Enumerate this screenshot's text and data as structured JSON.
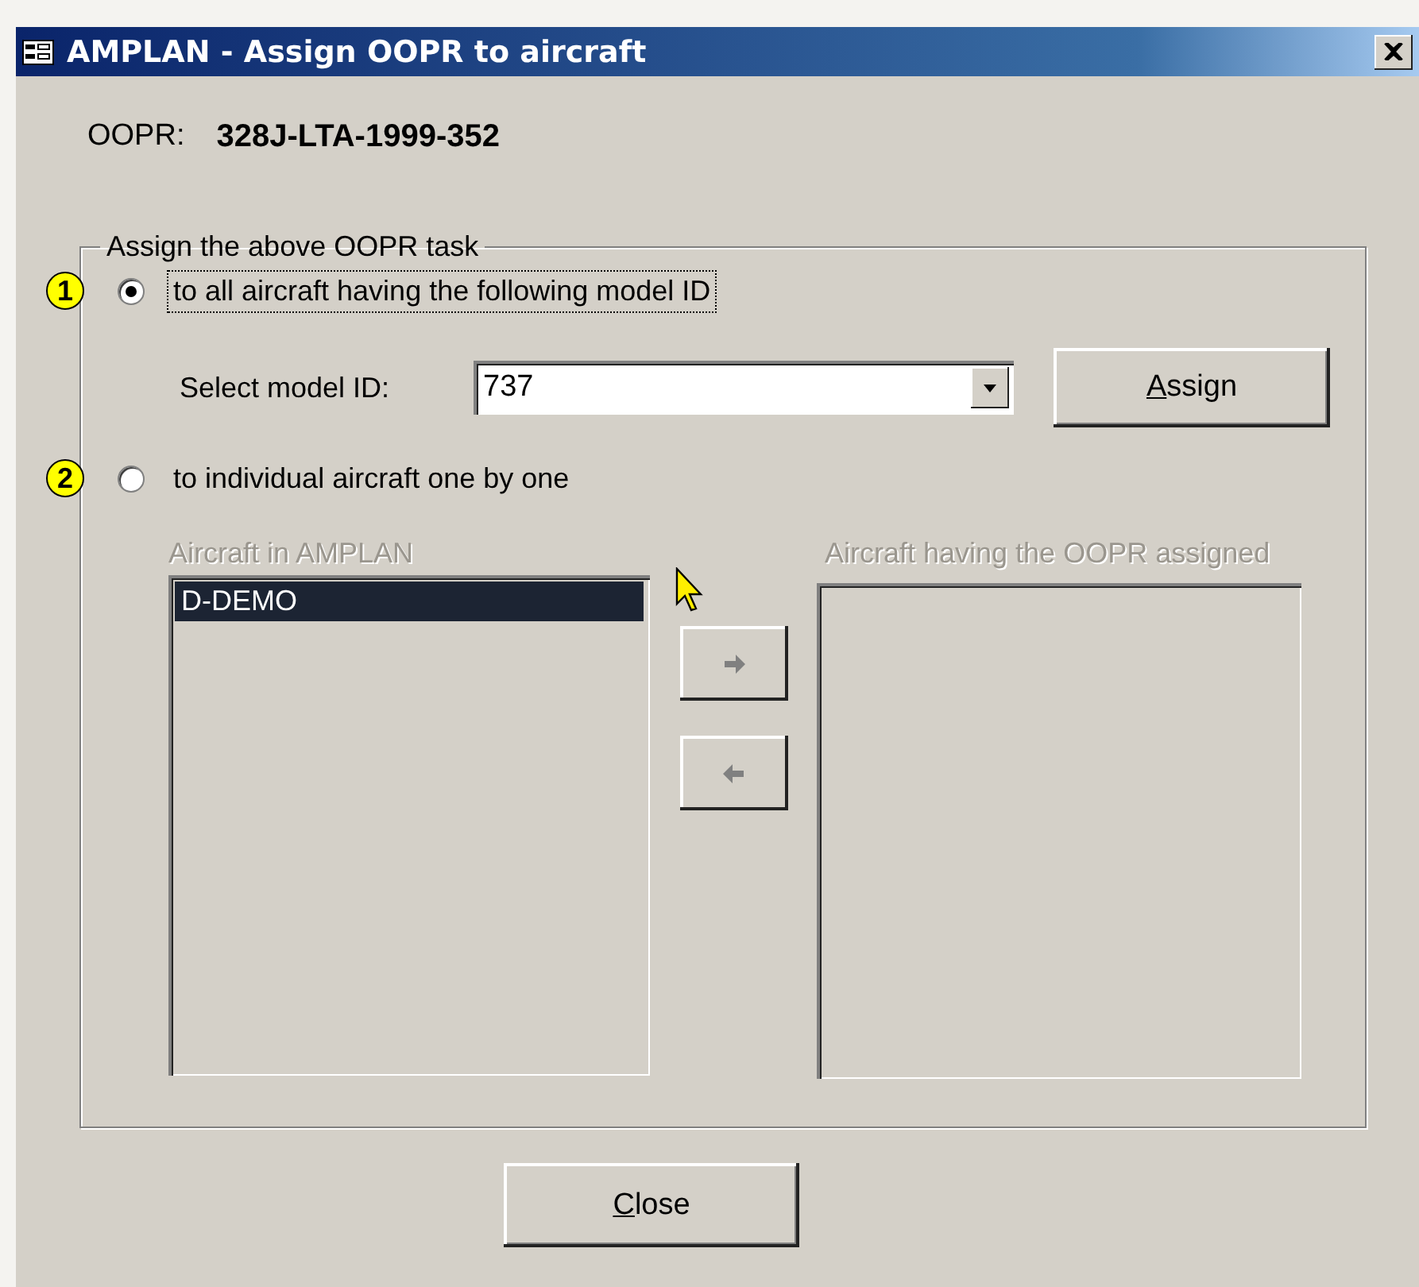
{
  "window": {
    "title": "AMPLAN - Assign OOPR to aircraft"
  },
  "oopr": {
    "label": "OOPR:",
    "value": "328J-LTA-1999-352"
  },
  "group": {
    "legend": "Assign the above OOPR task",
    "options": [
      {
        "badge": "1",
        "label": "to all aircraft having the following model ID",
        "selected": true,
        "focused": true
      },
      {
        "badge": "2",
        "label": "to individual aircraft one by one",
        "selected": false,
        "focused": false
      }
    ],
    "model": {
      "label": "Select model ID:",
      "value": "737"
    },
    "assign_button": {
      "label": "Assign",
      "mnemonic_first": true
    },
    "lists": [
      {
        "label": "Aircraft in AMPLAN",
        "disabled": true,
        "items": [
          {
            "text": "D-DEMO",
            "selected": true
          }
        ]
      },
      {
        "label": "Aircraft having the OOPR assigned",
        "disabled": true
      }
    ],
    "move_buttons": [
      {
        "kind": "right",
        "disabled": true
      },
      {
        "kind": "left",
        "disabled": true
      }
    ]
  },
  "close_button": {
    "label": "Close",
    "mnemonic_first": true
  }
}
